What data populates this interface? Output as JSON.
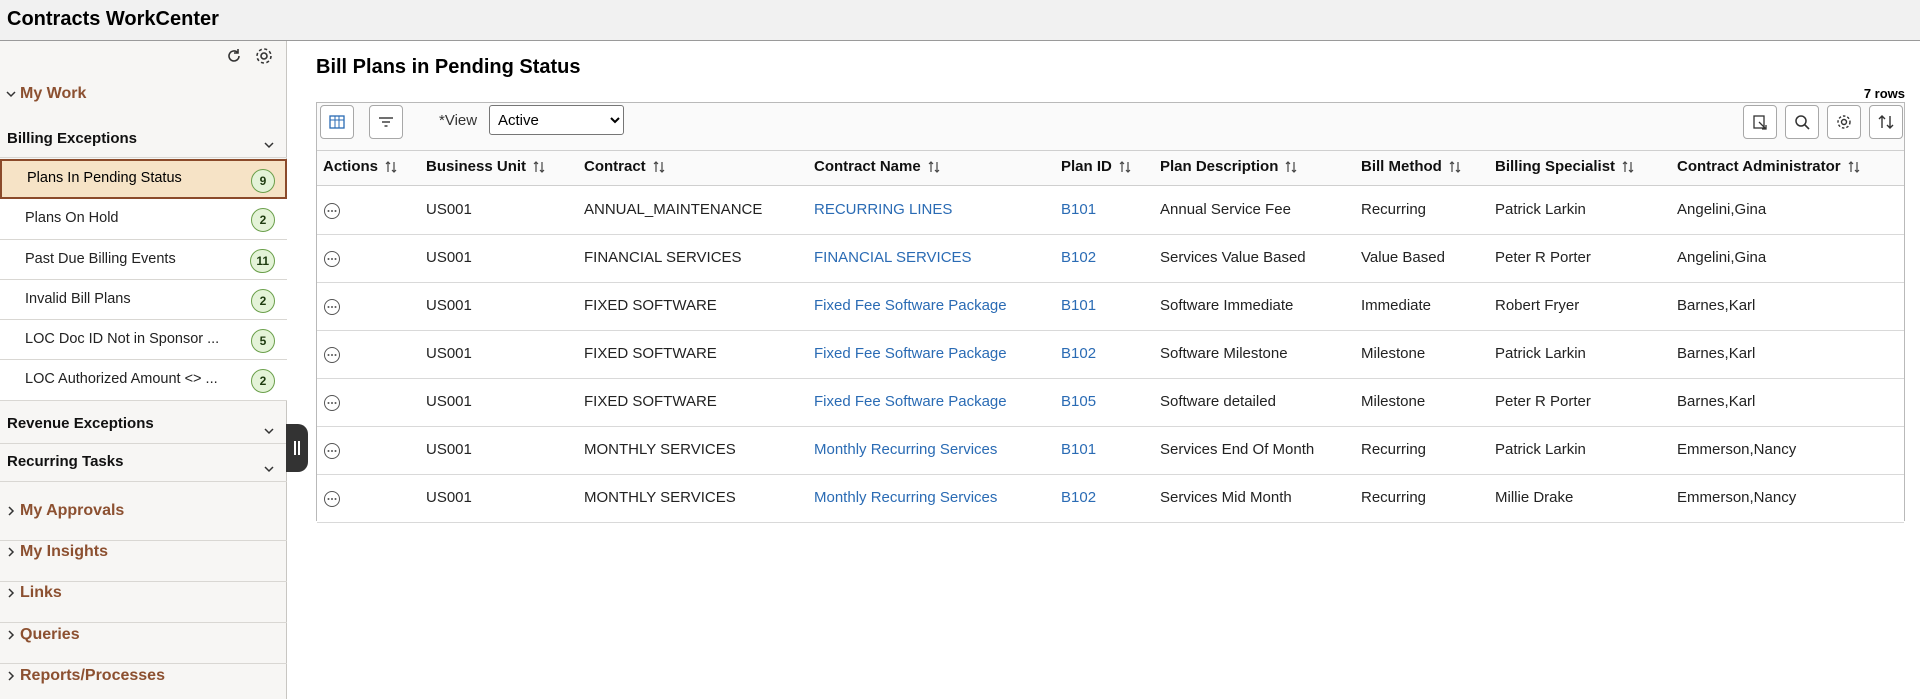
{
  "app": {
    "title": "Contracts WorkCenter"
  },
  "sidebar": {
    "my_work": "My Work",
    "billing_exceptions": "Billing Exceptions",
    "items": [
      {
        "label": "Plans In Pending Status",
        "count": "9"
      },
      {
        "label": "Plans On Hold",
        "count": "2"
      },
      {
        "label": "Past Due Billing Events",
        "count": "11"
      },
      {
        "label": "Invalid Bill Plans",
        "count": "2"
      },
      {
        "label": "LOC Doc ID Not in Sponsor ...",
        "count": "5"
      },
      {
        "label": "LOC Authorized Amount <> ...",
        "count": "2"
      }
    ],
    "revenue_exceptions": "Revenue Exceptions",
    "recurring_tasks": "Recurring Tasks",
    "sections": [
      "My Approvals",
      "My Insights",
      "Links",
      "Queries",
      "Reports/Processes"
    ]
  },
  "main": {
    "title": "Bill Plans in Pending Status",
    "row_count": "7 rows",
    "view_label": "*View",
    "view_value": "Active",
    "columns": [
      "Actions",
      "Business Unit",
      "Contract",
      "Contract Name",
      "Plan ID",
      "Plan Description",
      "Bill Method",
      "Billing Specialist",
      "Contract Administrator"
    ],
    "rows": [
      [
        "US001",
        "ANNUAL_MAINTENANCE",
        "RECURRING LINES",
        "B101",
        "Annual Service Fee",
        "Recurring",
        "Patrick Larkin",
        "Angelini,Gina"
      ],
      [
        "US001",
        "FINANCIAL SERVICES",
        "FINANCIAL SERVICES",
        "B102",
        "Services Value Based",
        "Value Based",
        "Peter R Porter",
        "Angelini,Gina"
      ],
      [
        "US001",
        "FIXED SOFTWARE",
        "Fixed Fee Software Package",
        "B101",
        "Software Immediate",
        "Immediate",
        "Robert Fryer",
        "Barnes,Karl"
      ],
      [
        "US001",
        "FIXED SOFTWARE",
        "Fixed Fee Software Package",
        "B102",
        "Software Milestone",
        "Milestone",
        "Patrick Larkin",
        "Barnes,Karl"
      ],
      [
        "US001",
        "FIXED SOFTWARE",
        "Fixed Fee Software Package",
        "B105",
        "Software detailed",
        "Milestone",
        "Peter R Porter",
        "Barnes,Karl"
      ],
      [
        "US001",
        "MONTHLY SERVICES",
        "Monthly Recurring Services",
        "B101",
        "Services End Of Month",
        "Recurring",
        "Patrick Larkin",
        "Emmerson,Nancy"
      ],
      [
        "US001",
        "MONTHLY SERVICES",
        "Monthly Recurring Services",
        "B102",
        "Services Mid Month",
        "Recurring",
        "Millie Drake",
        "Emmerson,Nancy"
      ]
    ]
  },
  "colors": {
    "accent_brown": "#8c5030",
    "link_blue": "#2a6bb4",
    "badge_green": "#e4f3d8",
    "active_bg": "#f6e3c6"
  },
  "icons": [
    "refresh-icon",
    "gear-icon",
    "chevron-down-icon",
    "chevron-right-icon",
    "grid-layout-icon",
    "filter-icon",
    "export-icon",
    "search-icon",
    "settings-icon",
    "sort-icon",
    "ellipsis-icon",
    "collapse-handle-icon"
  ]
}
